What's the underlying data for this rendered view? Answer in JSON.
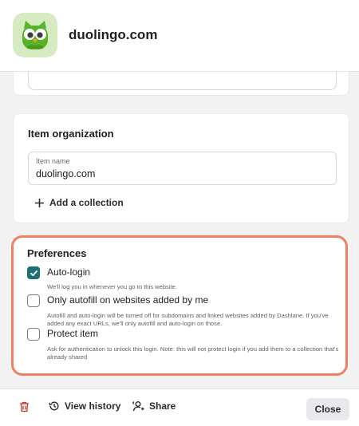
{
  "header": {
    "site_title": "duolingo.com",
    "icon": "duolingo-owl-logo"
  },
  "organization": {
    "title": "Item organization",
    "item_name_label": "Item name",
    "item_name_value": "duolingo.com",
    "add_collection_label": "Add a collection"
  },
  "preferences": {
    "title": "Preferences",
    "items": [
      {
        "label": "Auto-login",
        "checked": true,
        "description": "We'll log you in whenever you go to this website."
      },
      {
        "label": "Only autofill on websites added by me",
        "checked": false,
        "description": "Autofill and auto-login will be turned off for subdomains and linked websites added by Dashlane. If you've added any exact URLs, we'll only autofill and auto-login on those."
      },
      {
        "label": "Protect item",
        "checked": false,
        "description": "Ask for authentication to unlock this login. Note: this will not protect login if you add them to a collection that's already shared"
      }
    ],
    "highlight_color": "#f07f63",
    "checkbox_color": "#1d6f73"
  },
  "footer": {
    "delete_icon": "trash-icon",
    "view_history_label": "View history",
    "share_label": "Share",
    "close_label": "Close",
    "delete_color": "#c4352b"
  }
}
